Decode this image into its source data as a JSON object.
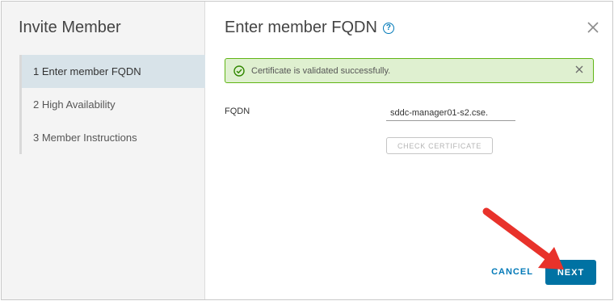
{
  "sidebar": {
    "title": "Invite Member",
    "steps": [
      {
        "label": "1 Enter member FQDN"
      },
      {
        "label": "2 High Availability"
      },
      {
        "label": "3 Member Instructions"
      }
    ]
  },
  "main": {
    "title": "Enter member FQDN",
    "help_icon": "?",
    "alert": {
      "text": "Certificate is validated successfully."
    },
    "fqdn": {
      "label": "FQDN",
      "value": "sddc-manager01-s2.cse."
    },
    "check_certificate_label": "CHECK CERTIFICATE",
    "cancel_label": "CANCEL",
    "next_label": "NEXT"
  },
  "colors": {
    "accent": "#0072a3",
    "success_border": "#60b515",
    "success_bg": "#dff0d0",
    "annotation_arrow": "#e8322b"
  },
  "icons": [
    "help-icon",
    "close-icon",
    "check-circle-icon",
    "alert-close-icon"
  ]
}
